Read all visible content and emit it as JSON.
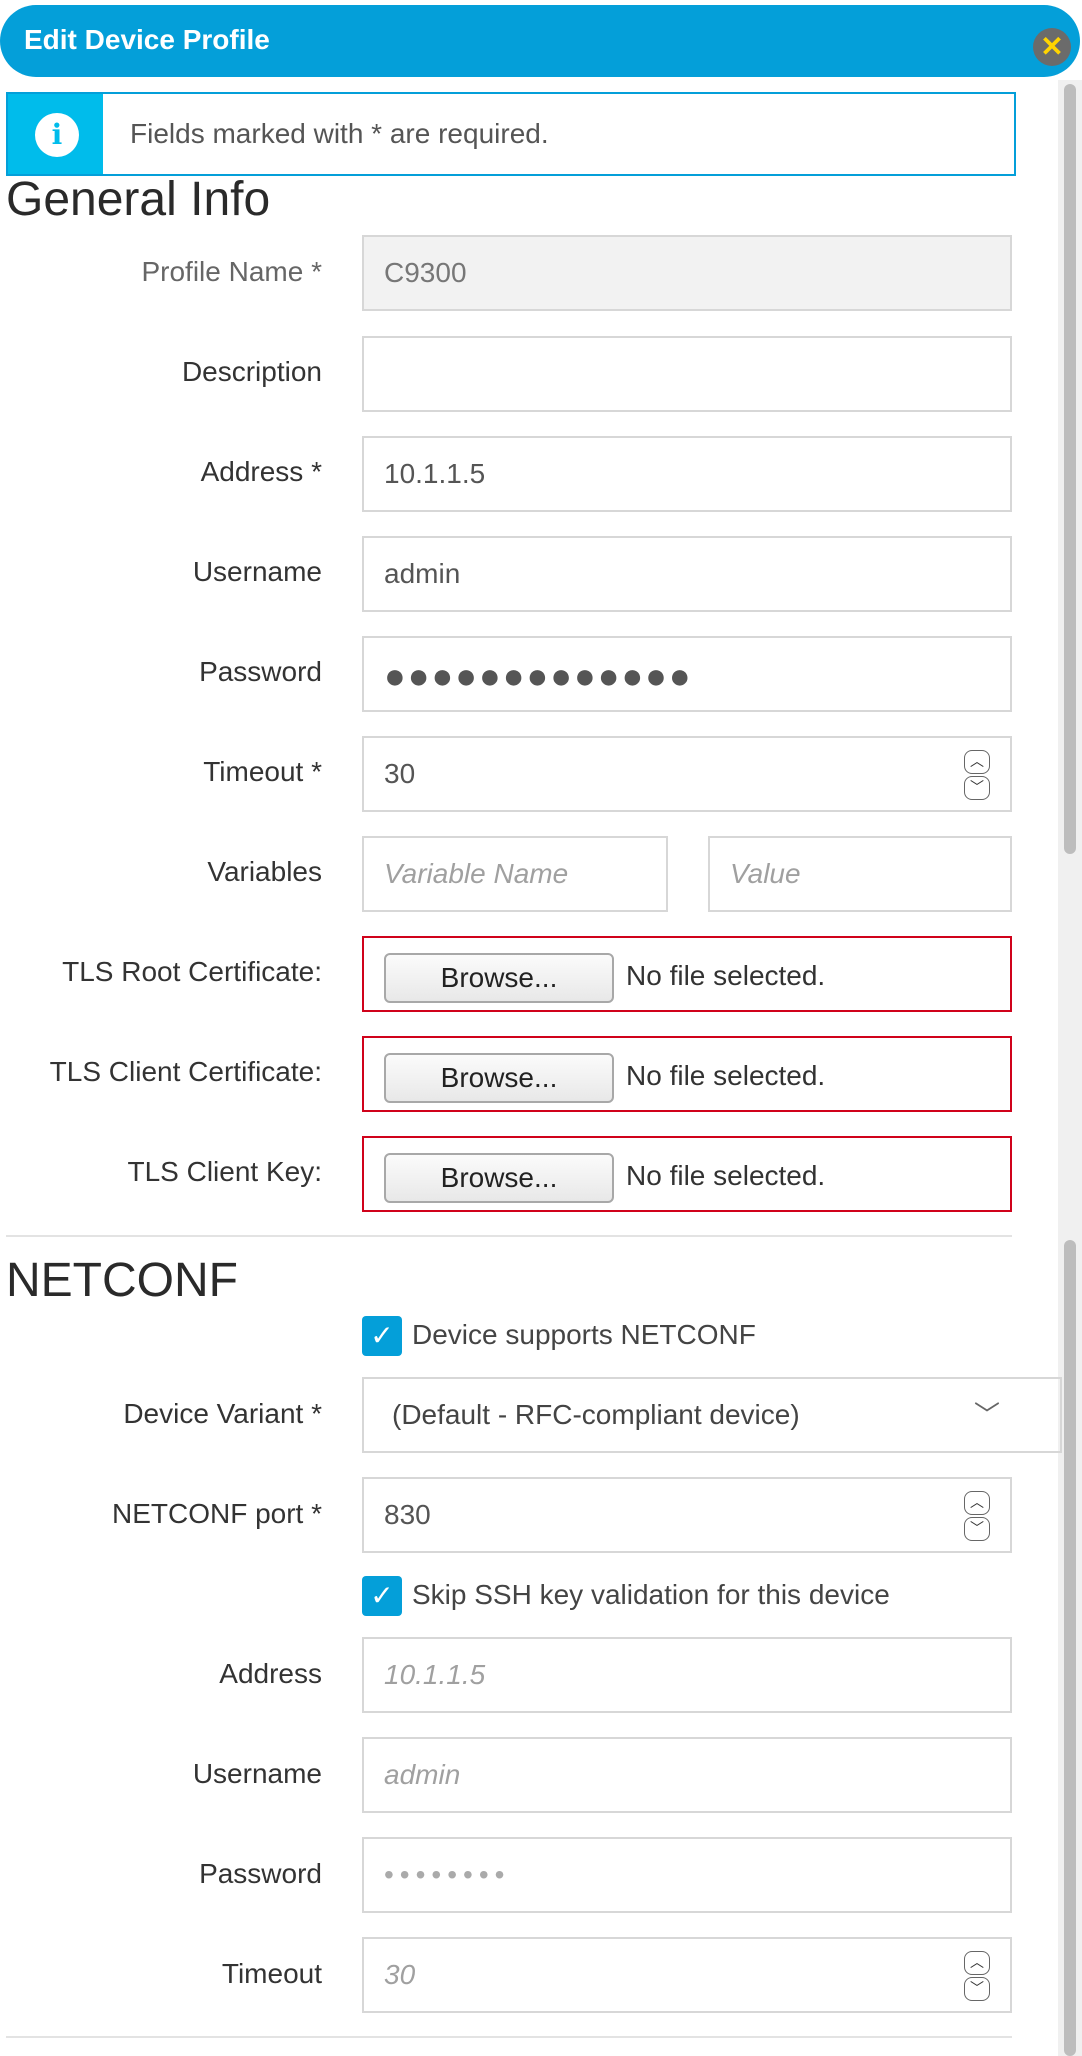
{
  "dialog": {
    "title": "Edit Device Profile",
    "close_icon": "close-icon",
    "accent_color": "#049fd9"
  },
  "info_banner": {
    "icon": "info-icon",
    "icon_glyph": "i",
    "text": "Fields marked with * are required."
  },
  "general_info": {
    "title": "General Info",
    "profile_name": {
      "label": "Profile Name *",
      "value": "C9300"
    },
    "description": {
      "label": "Description",
      "value": ""
    },
    "address": {
      "label": "Address *",
      "value": "10.1.1.5"
    },
    "username": {
      "label": "Username",
      "value": "admin"
    },
    "password": {
      "label": "Password",
      "value": "●●●●●●●●●●●●●"
    },
    "timeout": {
      "label": "Timeout *",
      "value": "30"
    },
    "variables": {
      "label": "Variables",
      "name_placeholder": "Variable Name",
      "value_placeholder": "Value"
    },
    "tls_root_cert": {
      "label": "TLS Root Certificate:",
      "button": "Browse...",
      "status": "No file selected."
    },
    "tls_client_cert": {
      "label": "TLS Client Certificate:",
      "button": "Browse...",
      "status": "No file selected."
    },
    "tls_client_key": {
      "label": "TLS Client Key:",
      "button": "Browse...",
      "status": "No file selected."
    }
  },
  "netconf": {
    "title": "NETCONF",
    "supports_netconf": {
      "label": "Device supports NETCONF",
      "checked": true
    },
    "device_variant": {
      "label": "Device Variant *",
      "selected": "(Default - RFC-compliant device)"
    },
    "port": {
      "label": "NETCONF port *",
      "value": "830"
    },
    "skip_ssh": {
      "label": "Skip SSH key validation for this device",
      "checked": true
    },
    "address": {
      "label": "Address",
      "placeholder": "10.1.1.5"
    },
    "username": {
      "label": "Username",
      "placeholder": "admin"
    },
    "password": {
      "label": "Password",
      "placeholder": "••••••••"
    },
    "timeout": {
      "label": "Timeout",
      "placeholder": "30"
    }
  }
}
